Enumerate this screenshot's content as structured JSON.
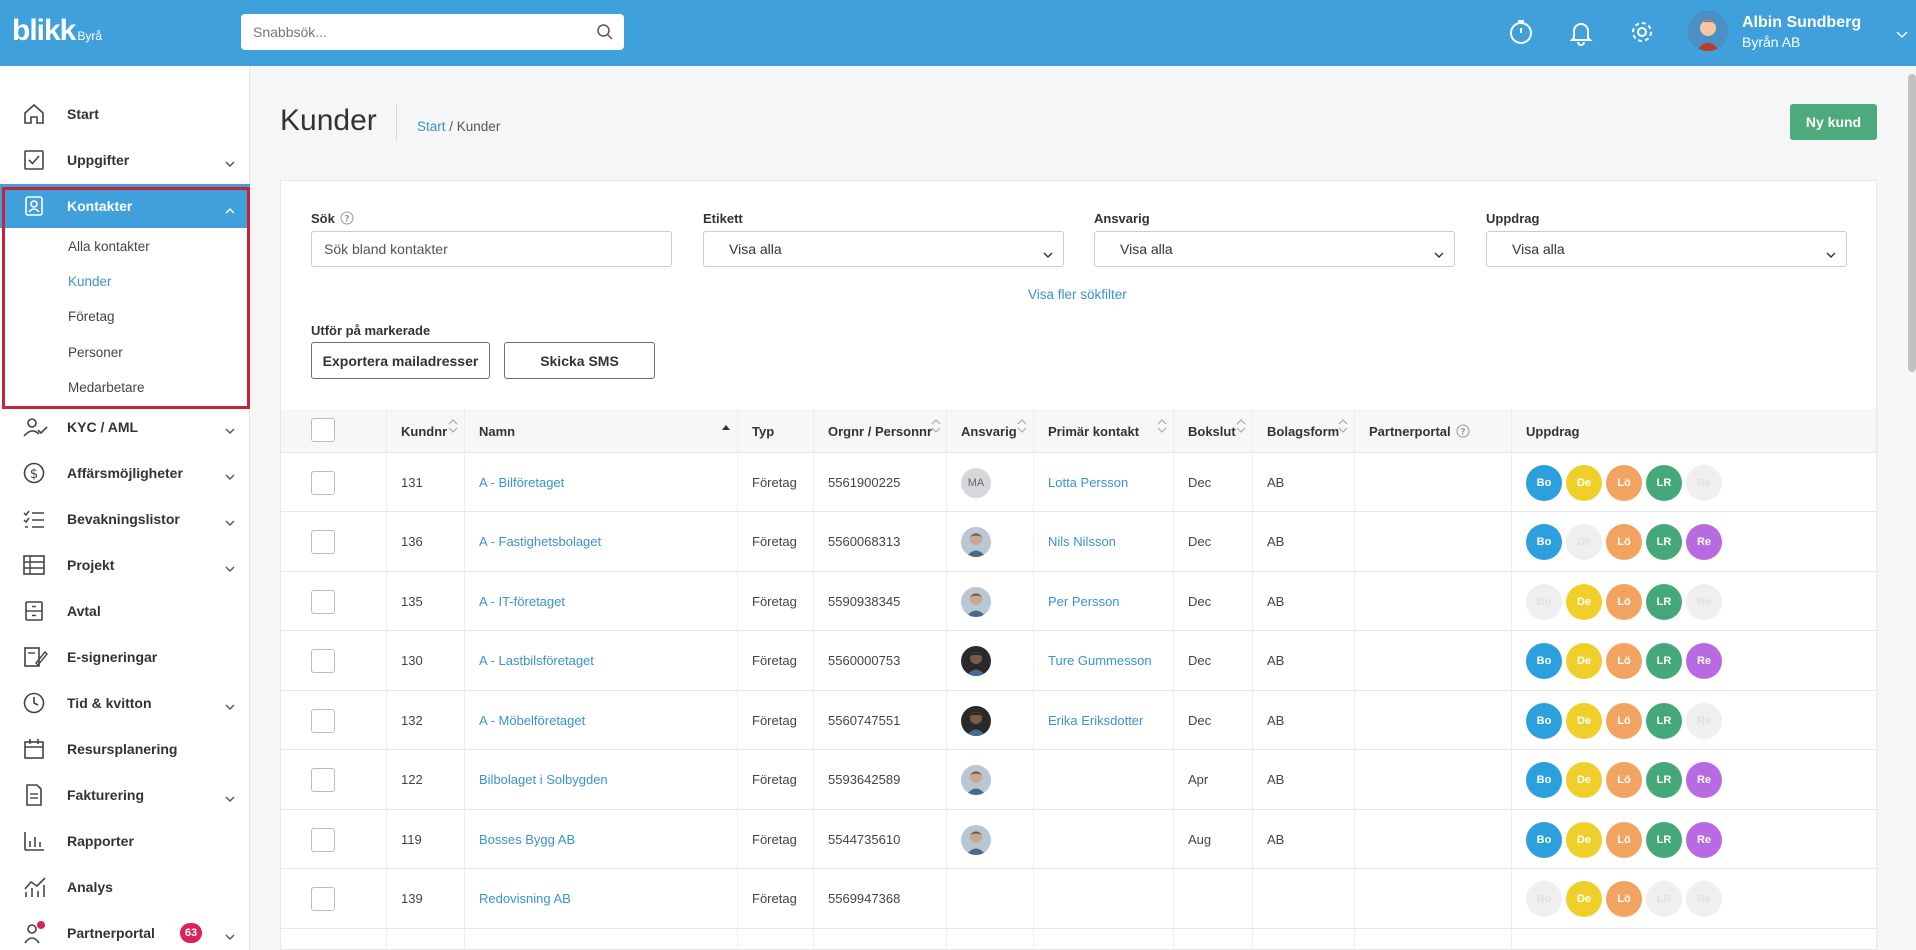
{
  "header": {
    "logo": "blikk",
    "logo_sub": "Byrå",
    "search_placeholder": "Snabbsök...",
    "user_name": "Albin Sundberg",
    "user_org": "Byrån AB"
  },
  "sidebar": {
    "items": [
      {
        "label": "Start",
        "icon": "home-icon",
        "caret": false
      },
      {
        "label": "Uppgifter",
        "icon": "checkbox-icon",
        "caret": true
      },
      {
        "label": "Kontakter",
        "icon": "contact-icon",
        "caret": true,
        "active": true
      },
      {
        "label": "KYC / AML",
        "icon": "user-check-icon",
        "caret": true
      },
      {
        "label": "Affärsmöjligheter",
        "icon": "dollar-icon",
        "caret": true
      },
      {
        "label": "Bevakningslistor",
        "icon": "checklist-icon",
        "caret": true
      },
      {
        "label": "Projekt",
        "icon": "table-icon",
        "caret": true
      },
      {
        "label": "Avtal",
        "icon": "archive-icon",
        "caret": false
      },
      {
        "label": "E-signeringar",
        "icon": "signature-icon",
        "caret": false
      },
      {
        "label": "Tid & kvitton",
        "icon": "clock-icon",
        "caret": true
      },
      {
        "label": "Resursplanering",
        "icon": "calendar-icon",
        "caret": false
      },
      {
        "label": "Fakturering",
        "icon": "invoice-icon",
        "caret": true
      },
      {
        "label": "Rapporter",
        "icon": "bar-chart-icon",
        "caret": false
      },
      {
        "label": "Analys",
        "icon": "analytics-icon",
        "caret": false
      },
      {
        "label": "Partnerportal",
        "icon": "partner-icon",
        "caret": true,
        "badge": "63"
      }
    ],
    "subitems": [
      "Alla kontakter",
      "Kunder",
      "Företag",
      "Personer",
      "Medarbetare"
    ]
  },
  "page": {
    "title": "Kunder",
    "breadcrumb_start": "Start",
    "breadcrumb_sep": " / ",
    "breadcrumb_current": "Kunder",
    "new_button": "Ny kund"
  },
  "filters": {
    "search_label": "Sök",
    "search_placeholder": "Sök bland kontakter",
    "etikett_label": "Etikett",
    "etikett_value": "Visa alla",
    "ansvarig_label": "Ansvarig",
    "ansvarig_value": "Visa alla",
    "uppdrag_label": "Uppdrag",
    "uppdrag_value": "Visa alla",
    "more_filters": "Visa fler sökfilter"
  },
  "actions": {
    "label": "Utför på markerade",
    "export_button": "Exportera mailadresser",
    "sms_button": "Skicka SMS"
  },
  "table": {
    "columns": {
      "kundnr": "Kundnr",
      "namn": "Namn",
      "typ": "Typ",
      "orgnr": "Orgnr / Personnr",
      "ansvarig": "Ansvarig",
      "primar": "Primär kontakt",
      "bokslut": "Bokslut",
      "bolagsform": "Bolagsform",
      "partnerportal": "Partnerportal",
      "uppdrag": "Uppdrag"
    },
    "chip_labels": [
      "Bo",
      "De",
      "Lö",
      "LR",
      "Re"
    ],
    "chip_colors": [
      "#2c9fdd",
      "#f0cf2b",
      "#f2a35f",
      "#45a87a",
      "#b86be0"
    ],
    "rows": [
      {
        "kundnr": "131",
        "namn": "A - Bilföretaget",
        "typ": "Företag",
        "orgnr": "5561900225",
        "ansvarig": "MA",
        "avatar": "initials",
        "primar": "Lotta Persson",
        "bokslut": "Dec",
        "bolagsform": "AB",
        "chips": [
          1,
          1,
          1,
          1,
          0
        ]
      },
      {
        "kundnr": "136",
        "namn": "A - Fastighetsbolaget",
        "typ": "Företag",
        "orgnr": "5560068313",
        "ansvarig": "",
        "avatar": "light",
        "primar": "Nils Nilsson",
        "bokslut": "Dec",
        "bolagsform": "AB",
        "chips": [
          1,
          0,
          1,
          1,
          1
        ]
      },
      {
        "kundnr": "135",
        "namn": "A - IT-företaget",
        "typ": "Företag",
        "orgnr": "5590938345",
        "ansvarig": "",
        "avatar": "light",
        "primar": "Per Persson",
        "bokslut": "Dec",
        "bolagsform": "AB",
        "chips": [
          0,
          1,
          1,
          1,
          0
        ]
      },
      {
        "kundnr": "130",
        "namn": "A - Lastbilsföretaget",
        "typ": "Företag",
        "orgnr": "5560000753",
        "ansvarig": "",
        "avatar": "dark",
        "primar": "Ture Gummesson",
        "bokslut": "Dec",
        "bolagsform": "AB",
        "chips": [
          1,
          1,
          1,
          1,
          1
        ]
      },
      {
        "kundnr": "132",
        "namn": "A - Möbelföretaget",
        "typ": "Företag",
        "orgnr": "5560747551",
        "ansvarig": "",
        "avatar": "dark",
        "primar": "Erika Eriksdotter",
        "bokslut": "Dec",
        "bolagsform": "AB",
        "chips": [
          1,
          1,
          1,
          1,
          0
        ]
      },
      {
        "kundnr": "122",
        "namn": "Bilbolaget i Solbygden",
        "typ": "Företag",
        "orgnr": "5593642589",
        "ansvarig": "",
        "avatar": "light",
        "primar": "",
        "bokslut": "Apr",
        "bolagsform": "AB",
        "chips": [
          1,
          1,
          1,
          1,
          1
        ]
      },
      {
        "kundnr": "119",
        "namn": "Bosses Bygg AB",
        "typ": "Företag",
        "orgnr": "5544735610",
        "ansvarig": "",
        "avatar": "light",
        "primar": "",
        "bokslut": "Aug",
        "bolagsform": "AB",
        "chips": [
          1,
          1,
          1,
          1,
          1
        ]
      },
      {
        "kundnr": "139",
        "namn": "Redovisning AB",
        "typ": "Företag",
        "orgnr": "5569947368",
        "ansvarig": "",
        "avatar": "none",
        "primar": "",
        "bokslut": "",
        "bolagsform": "",
        "chips": [
          0,
          1,
          1,
          0,
          0
        ]
      }
    ]
  }
}
